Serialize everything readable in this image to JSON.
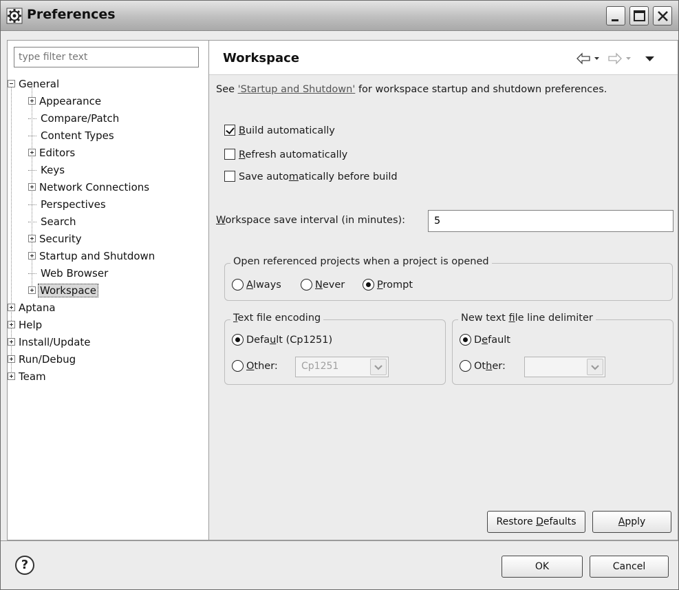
{
  "window": {
    "title": "Preferences",
    "icons": {
      "app": "gear-icon",
      "minimize": "minimize-icon",
      "maximize": "maximize-icon",
      "close": "close-icon"
    }
  },
  "left": {
    "filter_placeholder": "type filter text",
    "tree": [
      {
        "label": "General",
        "expander": "minus",
        "level": 0
      },
      {
        "label": "Appearance",
        "expander": "plus",
        "level": 1
      },
      {
        "label": "Compare/Patch",
        "expander": "none",
        "level": 1
      },
      {
        "label": "Content Types",
        "expander": "none",
        "level": 1
      },
      {
        "label": "Editors",
        "expander": "plus",
        "level": 1
      },
      {
        "label": "Keys",
        "expander": "none",
        "level": 1
      },
      {
        "label": "Network Connections",
        "expander": "plus",
        "level": 1
      },
      {
        "label": "Perspectives",
        "expander": "none",
        "level": 1
      },
      {
        "label": "Search",
        "expander": "none",
        "level": 1
      },
      {
        "label": "Security",
        "expander": "plus",
        "level": 1
      },
      {
        "label": "Startup and Shutdown",
        "expander": "plus",
        "level": 1
      },
      {
        "label": "Web Browser",
        "expander": "none",
        "level": 1
      },
      {
        "label": "Workspace",
        "expander": "plus",
        "level": 1,
        "selected": true
      },
      {
        "label": "Aptana",
        "expander": "plus",
        "level": 0
      },
      {
        "label": "Help",
        "expander": "plus",
        "level": 0
      },
      {
        "label": "Install/Update",
        "expander": "plus",
        "level": 0
      },
      {
        "label": "Run/Debug",
        "expander": "plus",
        "level": 0
      },
      {
        "label": "Team",
        "expander": "plus",
        "level": 0
      }
    ]
  },
  "page": {
    "title": "Workspace",
    "nav_icons": [
      "back-arrow-icon",
      "back-dropdown-icon",
      "forward-arrow-icon",
      "forward-dropdown-icon",
      "view-menu-icon"
    ],
    "desc_prefix": "See ",
    "desc_link": "'Startup and Shutdown'",
    "desc_suffix": " for workspace startup and shutdown preferences.",
    "build_auto": {
      "mn": "B",
      "rest": "uild automatically",
      "checked": true
    },
    "refresh_auto": {
      "mn": "R",
      "rest": "efresh automatically",
      "checked": false
    },
    "save_auto": {
      "pre": "Save auto",
      "mn": "m",
      "rest": "atically before build",
      "checked": false
    },
    "interval_label": {
      "mn": "W",
      "rest": "orkspace save interval (in minutes):"
    },
    "interval_value": "5",
    "open_group": {
      "title": "Open referenced projects when a project is opened",
      "always": {
        "mn": "A",
        "rest": "lways"
      },
      "never": {
        "mn": "N",
        "rest": "ever"
      },
      "prompt": {
        "mn": "P",
        "rest": "rompt"
      },
      "selected": "Prompt"
    },
    "encoding_group": {
      "title_mn": "T",
      "title_rest": "ext file encoding",
      "default": {
        "pre": "Defa",
        "mn": "u",
        "rest": "lt (Cp1251)"
      },
      "other": {
        "mn": "O",
        "rest": "ther:"
      },
      "other_value": "Cp1251",
      "selected": "Default"
    },
    "delimiter_group": {
      "title_pre": "New text ",
      "title_mn": "f",
      "title_rest": "ile line delimiter",
      "default": {
        "pre": "D",
        "mn": "e",
        "rest": "fault"
      },
      "other": {
        "pre": "Ot",
        "mn": "h",
        "rest": "er:"
      },
      "other_value": "",
      "selected": "Default"
    },
    "restore_defaults": {
      "pre": "Restore ",
      "mn": "D",
      "rest": "efaults"
    },
    "apply": {
      "mn": "A",
      "rest": "pply"
    }
  },
  "footer": {
    "help": "?",
    "ok": "OK",
    "cancel": "Cancel"
  }
}
